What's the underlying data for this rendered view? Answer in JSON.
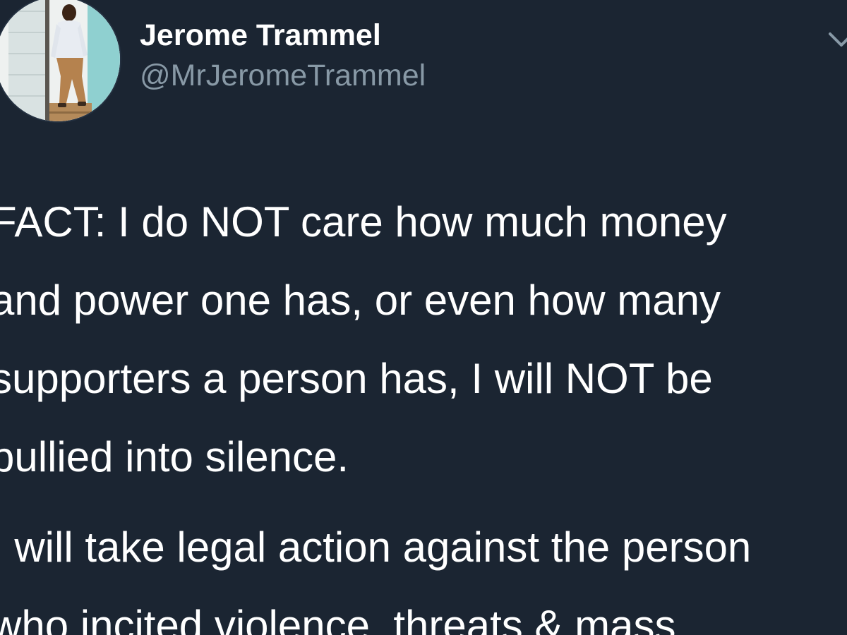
{
  "tweet": {
    "author": {
      "display_name": "Jerome Trammel",
      "handle": "@MrJeromeTrammel",
      "avatar_icon": "profile-photo"
    },
    "menu_icon": "chevron-down-icon",
    "paragraphs": [
      {
        "lines": [
          "FACT: I do NOT care how much money",
          "and power one has, or even how many",
          "supporters a person has, I will NOT be",
          "bullied into silence."
        ]
      },
      {
        "lines": [
          "I will take legal action against the person",
          "who incited violence, threats & mass"
        ]
      }
    ]
  },
  "colors": {
    "background": "#1b2532",
    "text": "#ffffff",
    "secondary_text": "#8899a6"
  }
}
